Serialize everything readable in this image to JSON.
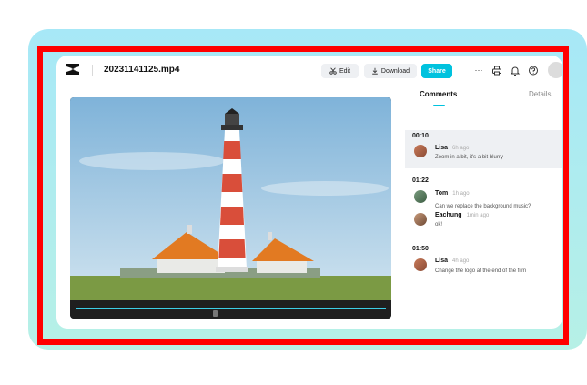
{
  "header": {
    "filename": "20231141125.mp4",
    "edit_label": "Edit",
    "download_label": "Download",
    "share_label": "Share"
  },
  "panel": {
    "tabs": [
      "Comments",
      "Details"
    ],
    "groups": [
      {
        "time": "00:10",
        "comments": [
          {
            "name": "Lisa",
            "ago": "6h ago",
            "text": "Zoom in a bit, it's a bit blurry"
          }
        ]
      },
      {
        "time": "01:22",
        "comments": [
          {
            "name": "Tom",
            "ago": "1h ago",
            "text": "Can we replace the background music?"
          },
          {
            "name": "Eachung",
            "ago": "1min ago",
            "text": "ok!"
          }
        ]
      },
      {
        "time": "01:50",
        "comments": [
          {
            "name": "Lisa",
            "ago": "4h ago",
            "text": "Change the logo at the end of the film"
          }
        ]
      }
    ]
  },
  "colors": {
    "accent": "#00c2de",
    "frame": "#ff0000"
  },
  "icons": [
    "capcut-logo-icon",
    "scissors-icon",
    "download-icon",
    "more-icon",
    "printer-icon",
    "bell-icon",
    "help-icon"
  ]
}
